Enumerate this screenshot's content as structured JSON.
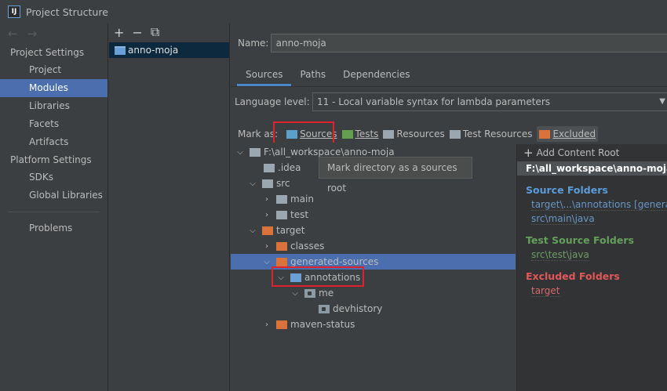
{
  "window": {
    "title": "Project Structure",
    "app_icon": "IJ"
  },
  "nav": {
    "back": "←",
    "forward": "→",
    "project_settings": "Project Settings",
    "project_items": [
      "Project",
      "Modules",
      "Libraries",
      "Facets",
      "Artifacts"
    ],
    "platform_settings": "Platform Settings",
    "platform_items": [
      "SDKs",
      "Global Libraries"
    ],
    "problems": "Problems"
  },
  "module_list": {
    "add": "+",
    "remove": "−",
    "copy": "⧉",
    "items": [
      "anno-moja"
    ]
  },
  "module": {
    "name_label": "Name:",
    "name_value": "anno-moja",
    "tabs": [
      "Sources",
      "Paths",
      "Dependencies"
    ],
    "language_label": "Language level:",
    "language_value": "11 - Local variable syntax for lambda parameters",
    "mark_as_label": "Mark as:",
    "mark_buttons": [
      "Sources",
      "Tests",
      "Resources",
      "Test Resources",
      "Excluded"
    ],
    "tooltip": "Mark directory as a sources root"
  },
  "tree": [
    {
      "label": "F:\\all_workspace\\anno-moja",
      "expanded": true
    },
    {
      "label": ".idea"
    },
    {
      "label": "src",
      "expanded": true
    },
    {
      "label": "main"
    },
    {
      "label": "test"
    },
    {
      "label": "target",
      "expanded": true
    },
    {
      "label": "classes"
    },
    {
      "label": "generated-sources"
    },
    {
      "label": "annotations",
      "expanded": true
    },
    {
      "label": "me",
      "expanded": true
    },
    {
      "label": "devhistory"
    },
    {
      "label": "maven-status"
    }
  ],
  "content_root": {
    "add_label": "Add Content Root",
    "path": "F:\\all_workspace\\anno-moja",
    "source_title": "Source Folders",
    "source_items": [
      "target\\...\\annotations [generated]",
      "src\\main\\java"
    ],
    "test_title": "Test Source Folders",
    "test_items": [
      "src\\test\\java"
    ],
    "excluded_title": "Excluded Folders",
    "excluded_items": [
      "target"
    ]
  }
}
